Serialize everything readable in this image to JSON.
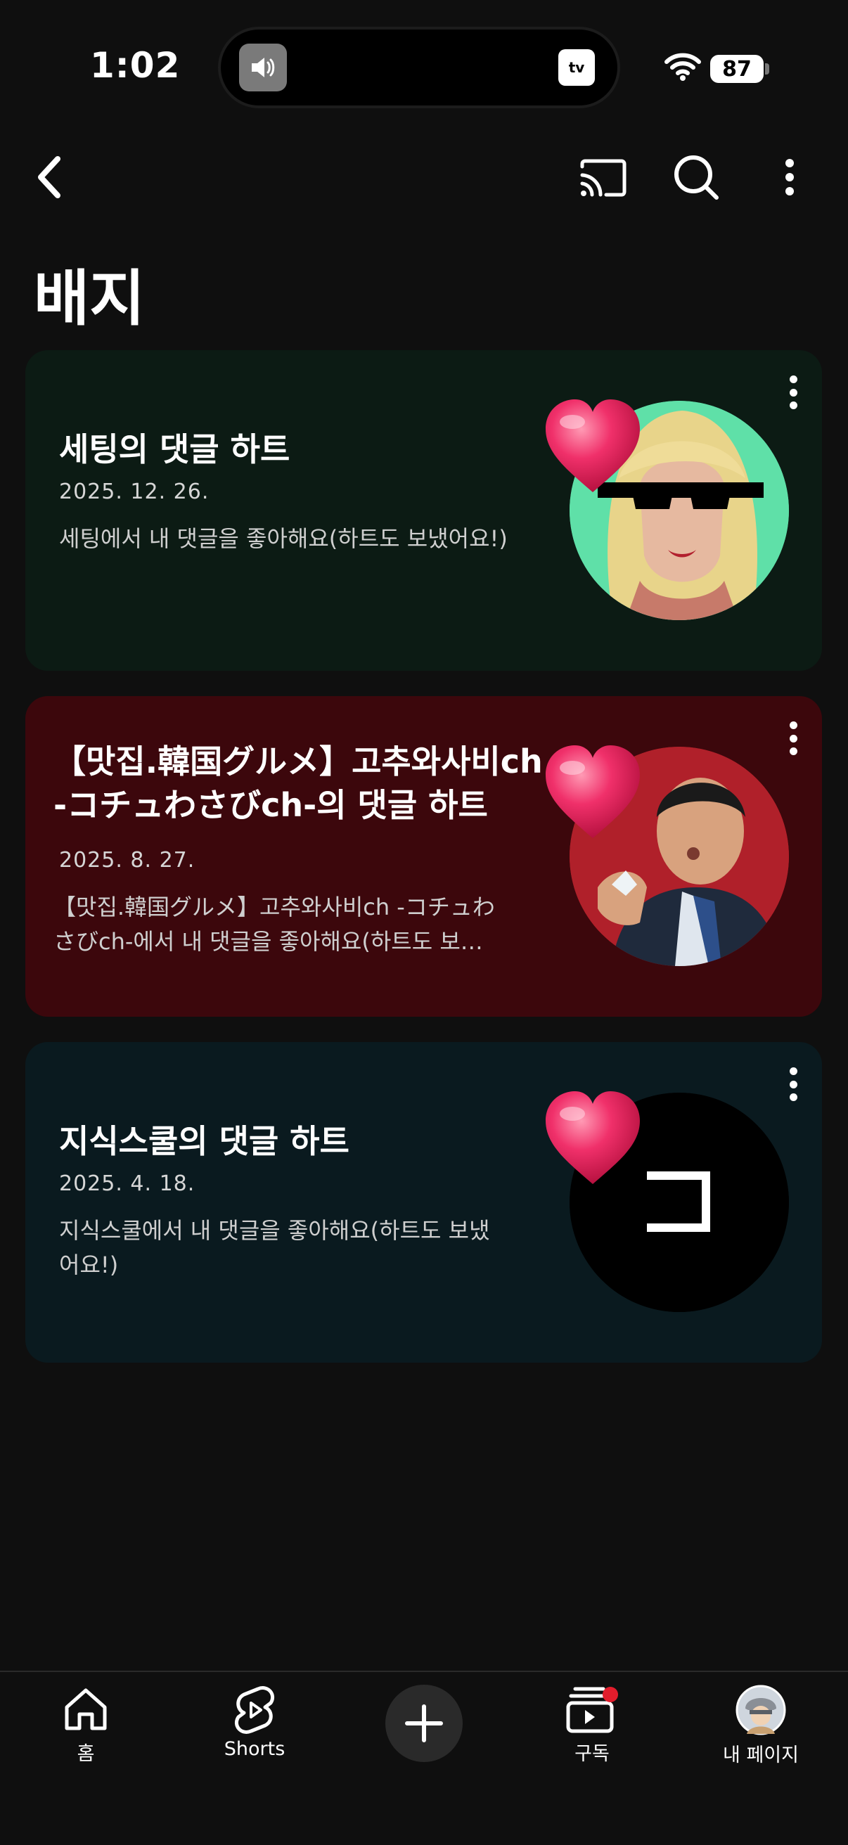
{
  "status_bar": {
    "time": "1:02",
    "battery": "87",
    "island_app": "tv"
  },
  "page": {
    "title": "배지"
  },
  "cards": [
    {
      "title": "세팅의 댓글 하트",
      "date": "2025. 12. 26.",
      "description": "세팅에서 내 댓글을 좋아해요(하트도 보냈어요!)",
      "background": "#0c1b14",
      "avatar_ring": "#5fe0a8"
    },
    {
      "title": "【맛집.韓国グルメ】고추와사비ch -コチュわさびch-의 댓글 하트",
      "date": "2025. 8. 27.",
      "description": "【맛집.韓国グルメ】고추와사비ch -コチュわさびch-에서 내 댓글을 좋아해요(하트도 보냈어요!)",
      "background": "#3c070c",
      "avatar_ring": "#b0202a"
    },
    {
      "title": "지식스쿨의 댓글 하트",
      "date": "2025. 4. 18.",
      "description": "지식스쿨에서 내 댓글을 좋아해요(하트도 보냈어요!)",
      "background": "#0a1a1f",
      "avatar_ring": "#000000"
    }
  ],
  "bottom_nav": {
    "home": "홈",
    "shorts": "Shorts",
    "subscriptions": "구독",
    "my_page": "내 페이지"
  },
  "colors": {
    "background": "#0f0f0f",
    "heart": "#e8245a",
    "notification_dot": "#e21d2c"
  }
}
